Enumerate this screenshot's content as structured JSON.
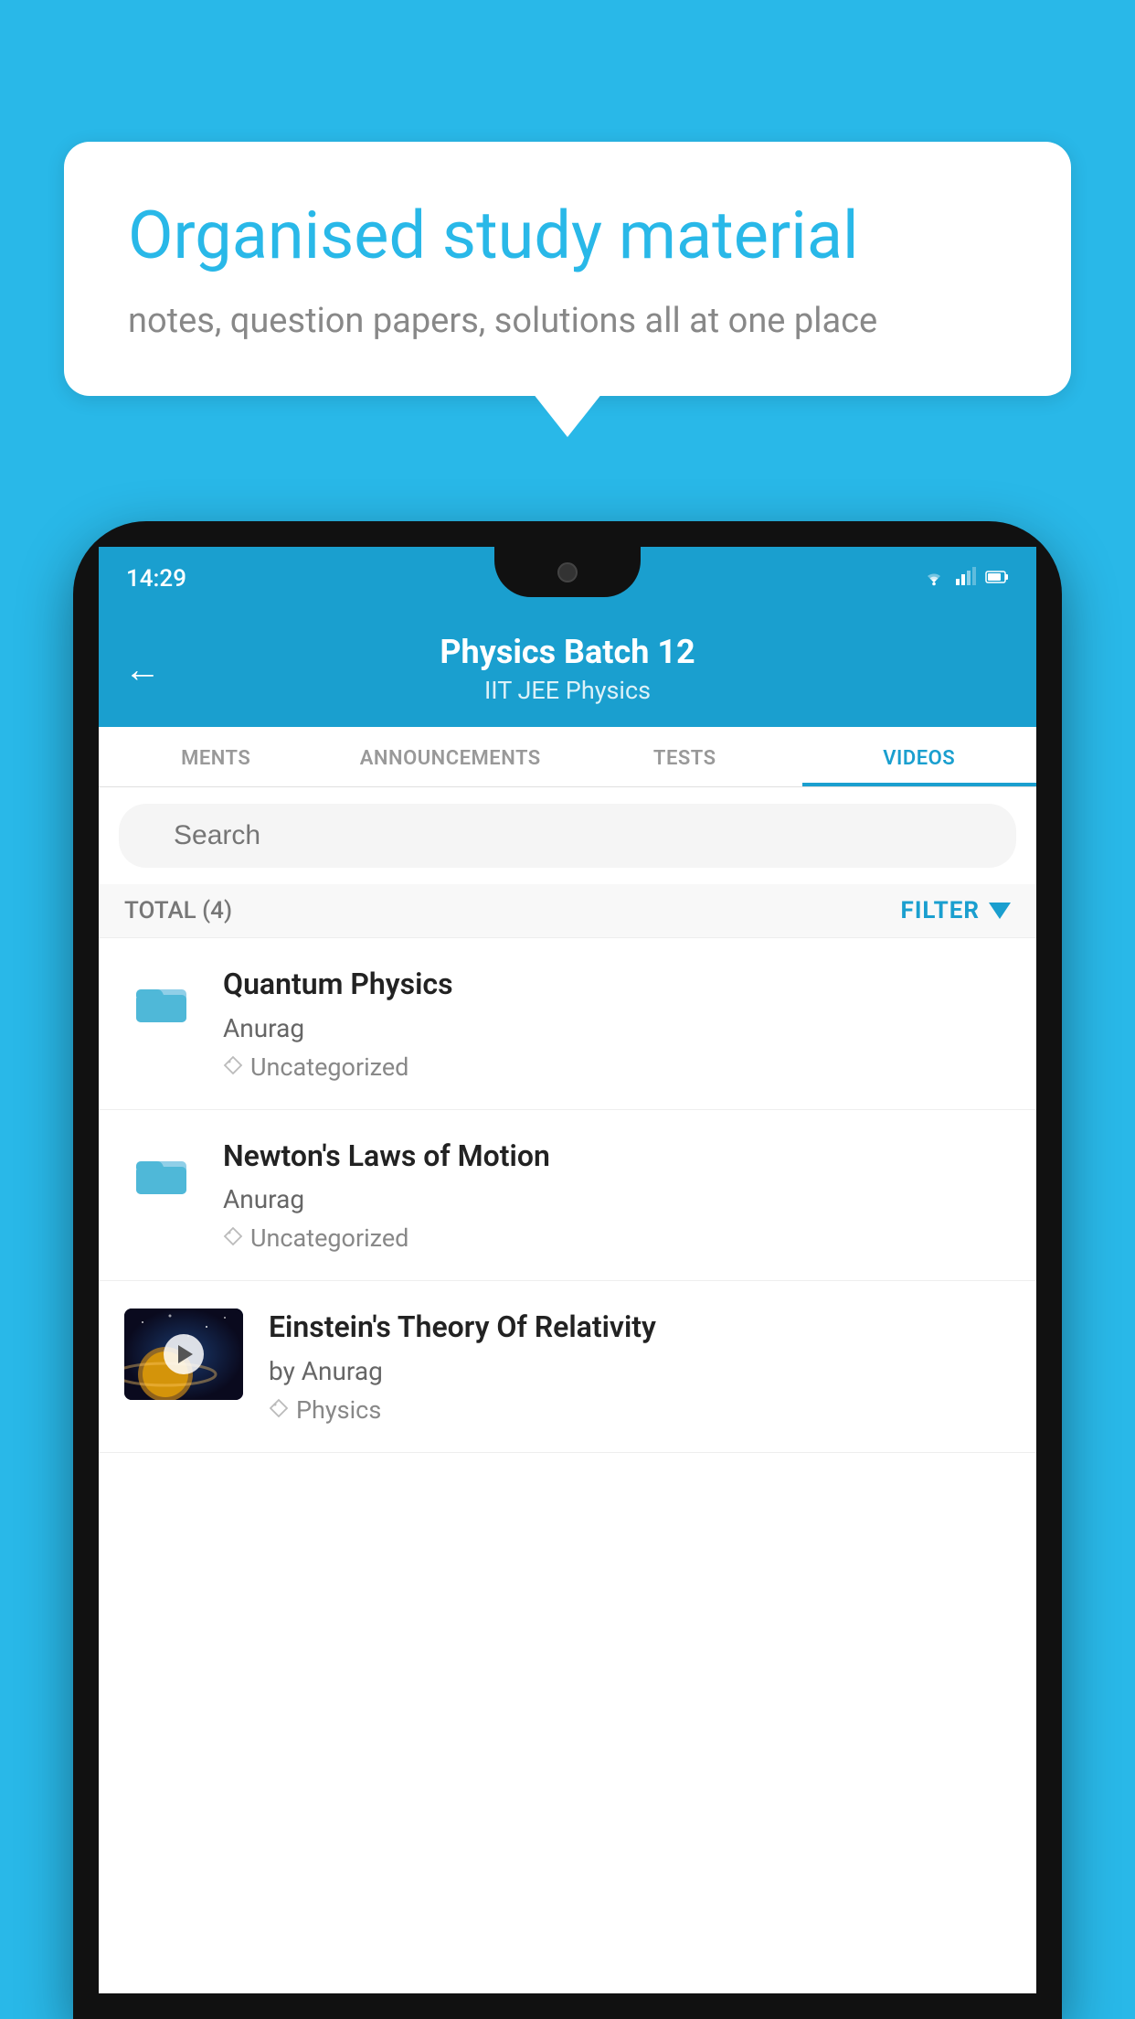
{
  "background_color": "#29b8e8",
  "speech_bubble": {
    "heading": "Organised study material",
    "subtext": "notes, question papers, solutions all at one place"
  },
  "phone": {
    "status_bar": {
      "time": "14:29",
      "wifi": "▾",
      "signal": "▴",
      "battery": "▮"
    },
    "app_header": {
      "back_label": "←",
      "title": "Physics Batch 12",
      "subtitle_tags": "IIT JEE   Physics"
    },
    "tabs": [
      {
        "label": "MENTS",
        "active": false
      },
      {
        "label": "ANNOUNCEMENTS",
        "active": false
      },
      {
        "label": "TESTS",
        "active": false
      },
      {
        "label": "VIDEOS",
        "active": true
      }
    ],
    "search": {
      "placeholder": "Search"
    },
    "filter_bar": {
      "total_label": "TOTAL (4)",
      "filter_label": "FILTER"
    },
    "video_items": [
      {
        "title": "Quantum Physics",
        "author": "Anurag",
        "tag": "Uncategorized",
        "has_thumbnail": false
      },
      {
        "title": "Newton's Laws of Motion",
        "author": "Anurag",
        "tag": "Uncategorized",
        "has_thumbnail": false
      },
      {
        "title": "Einstein's Theory Of Relativity",
        "author": "by Anurag",
        "tag": "Physics",
        "has_thumbnail": true
      }
    ]
  }
}
